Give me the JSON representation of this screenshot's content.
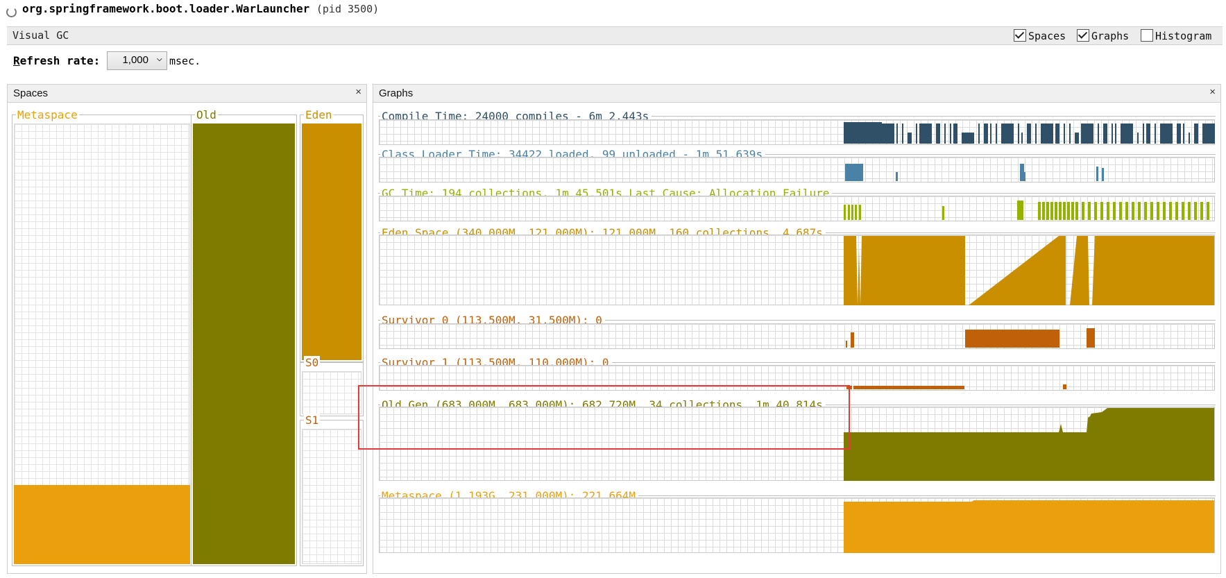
{
  "window": {
    "title": "org.springframework.boot.loader.WarLauncher",
    "pid": "(pid 3500)"
  },
  "tab": {
    "label": "Visual GC",
    "options": [
      {
        "label": "Spaces",
        "checked": true
      },
      {
        "label": "Graphs",
        "checked": true
      },
      {
        "label": "Histogram",
        "checked": false
      }
    ]
  },
  "refresh": {
    "label_mnemonic": "R",
    "label_rest": "efresh rate:",
    "value": "1,000",
    "unit": "msec."
  },
  "spaces_panel": {
    "title": "Spaces",
    "close": "×",
    "metaspace": {
      "label": "Metaspace",
      "fill": 0.18,
      "color": "#e9a00c"
    },
    "old": {
      "label": "Old",
      "fill": 1.0,
      "color": "#7f7b00"
    },
    "eden": {
      "label": "Eden",
      "fill": 1.0,
      "color": "#c98f00"
    },
    "s0": {
      "label": "S0",
      "fill": 0.0
    },
    "s1": {
      "label": "S1",
      "fill": 0.0
    }
  },
  "graphs_panel": {
    "title": "Graphs",
    "close": "×",
    "graphs": [
      {
        "key": "compile",
        "title": "Compile Time: 24000 compiles - 6m 2.443s",
        "color": "#2f5067"
      },
      {
        "key": "classloader",
        "title": "Class Loader Time: 34422 loaded, 99 unloaded - 1m 51.639s",
        "color": "#4a82a6"
      },
      {
        "key": "gc",
        "title": "GC Time: 194 collections, 1m 45.501s  Last Cause: Allocation Failure",
        "color": "#93b300"
      },
      {
        "key": "eden",
        "title": "Eden Space (340.000M, 121.000M): 121.000M, 160 collections, 4.687s",
        "color": "#c98f00"
      },
      {
        "key": "s0",
        "title": "Survivor 0 (113.500M, 31.500M): 0",
        "color": "#c0610a"
      },
      {
        "key": "s1",
        "title": "Survivor 1 (113.500M, 110.000M): 0",
        "color": "#c0610a"
      },
      {
        "key": "old",
        "title": "Old Gen (683.000M, 683.000M): 682.720M, 34 collections, 1m 40.814s",
        "color": "#7f7b00"
      },
      {
        "key": "meta",
        "title": "Metaspace (1.193G, 231.000M): 221.664M",
        "color": "#e9a00c"
      }
    ]
  },
  "highlight": {
    "color": "#e63a3a"
  }
}
